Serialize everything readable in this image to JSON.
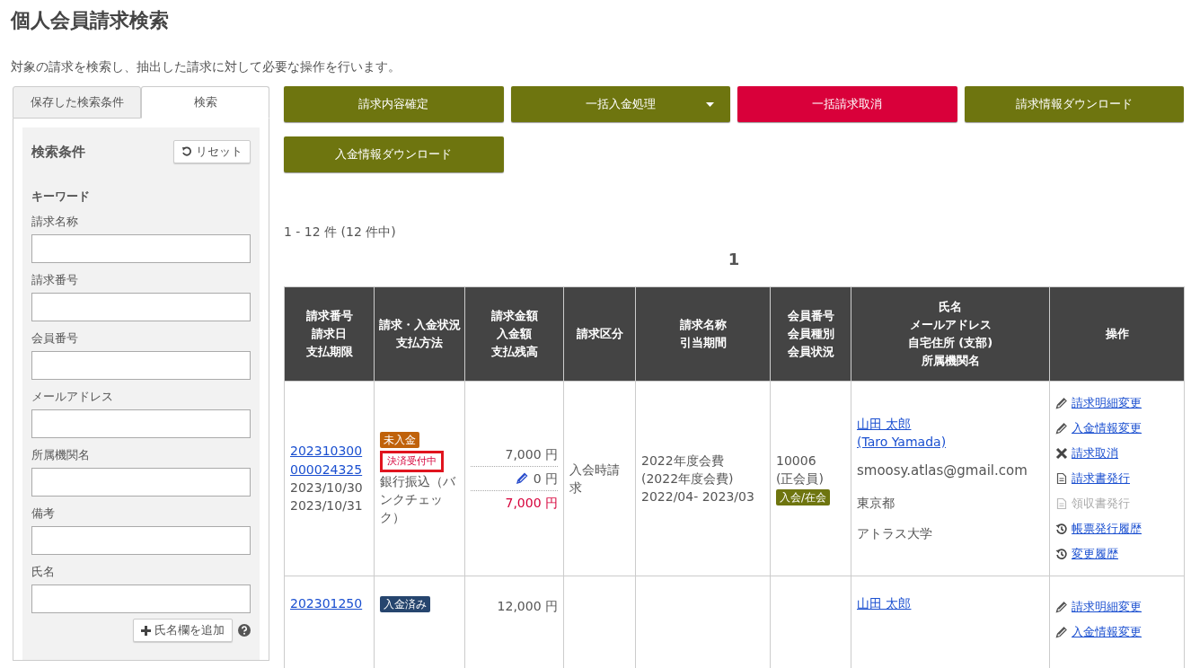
{
  "page": {
    "title": "個人会員請求検索",
    "description": "対象の請求を検索し、抽出した請求に対して必要な操作を行います。"
  },
  "sidebar": {
    "tabs": [
      {
        "label": "保存した検索条件",
        "selected": false
      },
      {
        "label": "検索",
        "selected": true
      }
    ],
    "panel": {
      "title": "検索条件",
      "reset_button": "リセット",
      "keyword_heading": "キーワード",
      "fields": [
        {
          "label": "請求名称"
        },
        {
          "label": "請求番号"
        },
        {
          "label": "会員番号"
        },
        {
          "label": "メールアドレス"
        },
        {
          "label": "所属機関名"
        },
        {
          "label": "備考"
        },
        {
          "label": "氏名"
        }
      ],
      "add_name_button": "氏名欄を追加"
    }
  },
  "actions": [
    {
      "label": "請求内容確定",
      "kind": "primary",
      "dropdown": false
    },
    {
      "label": "一括入金処理",
      "kind": "primary",
      "dropdown": true
    },
    {
      "label": "一括請求取消",
      "kind": "danger",
      "dropdown": false
    },
    {
      "label": "請求情報ダウンロード",
      "kind": "primary",
      "dropdown": false
    },
    {
      "label": "入金情報ダウンロード",
      "kind": "primary",
      "dropdown": false
    }
  ],
  "result_count": "1 - 12 件 (12 件中)",
  "pagination": [
    {
      "label": "1",
      "selected": true
    }
  ],
  "table": {
    "columns": [
      {
        "lines": [
          "請求番号",
          "請求日",
          "支払期限"
        ]
      },
      {
        "lines": [
          "請求・入金状況",
          "支払方法"
        ]
      },
      {
        "lines": [
          "請求金額",
          "入金額",
          "支払残高"
        ]
      },
      {
        "lines": [
          "請求区分"
        ]
      },
      {
        "lines": [
          "請求名称",
          "引当期間"
        ]
      },
      {
        "lines": [
          "会員番号",
          "会員種別",
          "会員状況"
        ]
      },
      {
        "lines": [
          "氏名",
          "メールアドレス",
          "自宅住所 (支部)",
          "所属機関名"
        ]
      },
      {
        "lines": [
          "操作"
        ]
      }
    ],
    "rows": [
      {
        "invoice_number": "202310300000024325",
        "invoice_date": "2023/10/30",
        "due_date": "2023/10/31",
        "payment_status": {
          "label": "未入金",
          "kind": "unpaid"
        },
        "settlement": {
          "label": "決済受付中",
          "highlighted": true
        },
        "payment_method": "銀行振込（バンクチェック）",
        "amounts": [
          {
            "label": "7,000 円",
            "kind": "billed"
          },
          {
            "label": "0 円",
            "kind": "paid"
          },
          {
            "label": "7,000 円",
            "kind": "balance"
          }
        ],
        "category": "入会時請求",
        "billing_name": "2022年度会費",
        "billing_name_sub": "(2022年度会費)",
        "period": "2022/04- 2023/03",
        "member_number": "10006",
        "member_type": "(正会員)",
        "member_status": "入会/在会",
        "name": "山田 太郎",
        "name_en": "(Taro Yamada)",
        "email": "smoosy.atlas@gmail.com",
        "address": "東京都",
        "institution": "アトラス大学",
        "operations": [
          {
            "label": "請求明細変更",
            "kind": "edit",
            "disabled": false
          },
          {
            "label": "入金情報変更",
            "kind": "edit",
            "disabled": false
          },
          {
            "label": "請求取消",
            "kind": "cancel",
            "disabled": false
          },
          {
            "label": "請求書発行",
            "kind": "issue",
            "disabled": false
          },
          {
            "label": "領収書発行",
            "kind": "issue",
            "disabled": true
          },
          {
            "label": "帳票発行履歴",
            "kind": "history",
            "disabled": false
          },
          {
            "label": "変更履歴",
            "kind": "history",
            "disabled": false
          }
        ]
      },
      {
        "invoice_number": "202301250",
        "payment_status": {
          "label": "入金済み",
          "kind": "paid"
        },
        "amounts": [
          {
            "label": "12,000 円",
            "kind": "billed"
          }
        ],
        "name": "山田 太郎",
        "operations": [
          {
            "label": "請求明細変更",
            "kind": "edit",
            "disabled": false
          },
          {
            "label": "入金情報変更",
            "kind": "edit",
            "disabled": false
          }
        ]
      }
    ]
  }
}
